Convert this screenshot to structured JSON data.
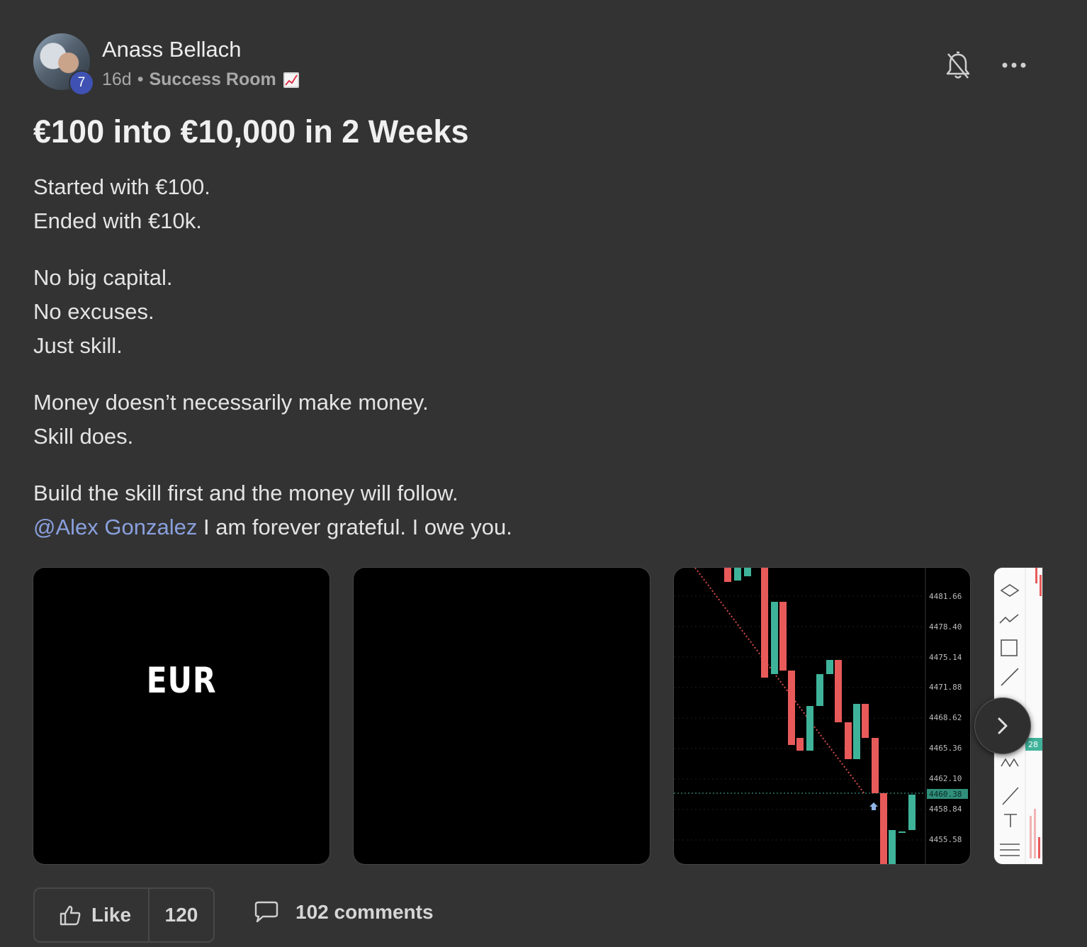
{
  "post": {
    "author": "Anass Bellach",
    "level": "7",
    "age": "16d",
    "separator": "•",
    "room": "Success Room",
    "title": "€100 into €10,000 in 2 Weeks",
    "paragraphs": [
      [
        "Started with €100.",
        "Ended with €10k."
      ],
      [
        "No big capital.",
        "No excuses.",
        "Just skill."
      ],
      [
        "Money doesn’t necessarily make money.",
        "Skill does."
      ],
      [
        "Build the skill first and the money will follow."
      ]
    ],
    "mention": "@Alex Gonzalez",
    "mention_text": " I am forever grateful. I owe you."
  },
  "media": {
    "tile1_label": "EUR",
    "chart_price_labels": [
      "4481.66",
      "4478.40",
      "4475.14",
      "4471.88",
      "4468.62",
      "4465.36",
      "4462.10",
      "4460.38",
      "4458.84",
      "4455.58"
    ],
    "current_price": "4460.38",
    "side_badge": "28"
  },
  "actions": {
    "like_label": "Like",
    "like_count": "120",
    "comments_label": "102 comments"
  },
  "colors": {
    "background": "#333333",
    "mention": "#8aa0de",
    "level_badge": "#3f52b3",
    "candle_up": "#3fb39a",
    "candle_down": "#e85a5a"
  }
}
